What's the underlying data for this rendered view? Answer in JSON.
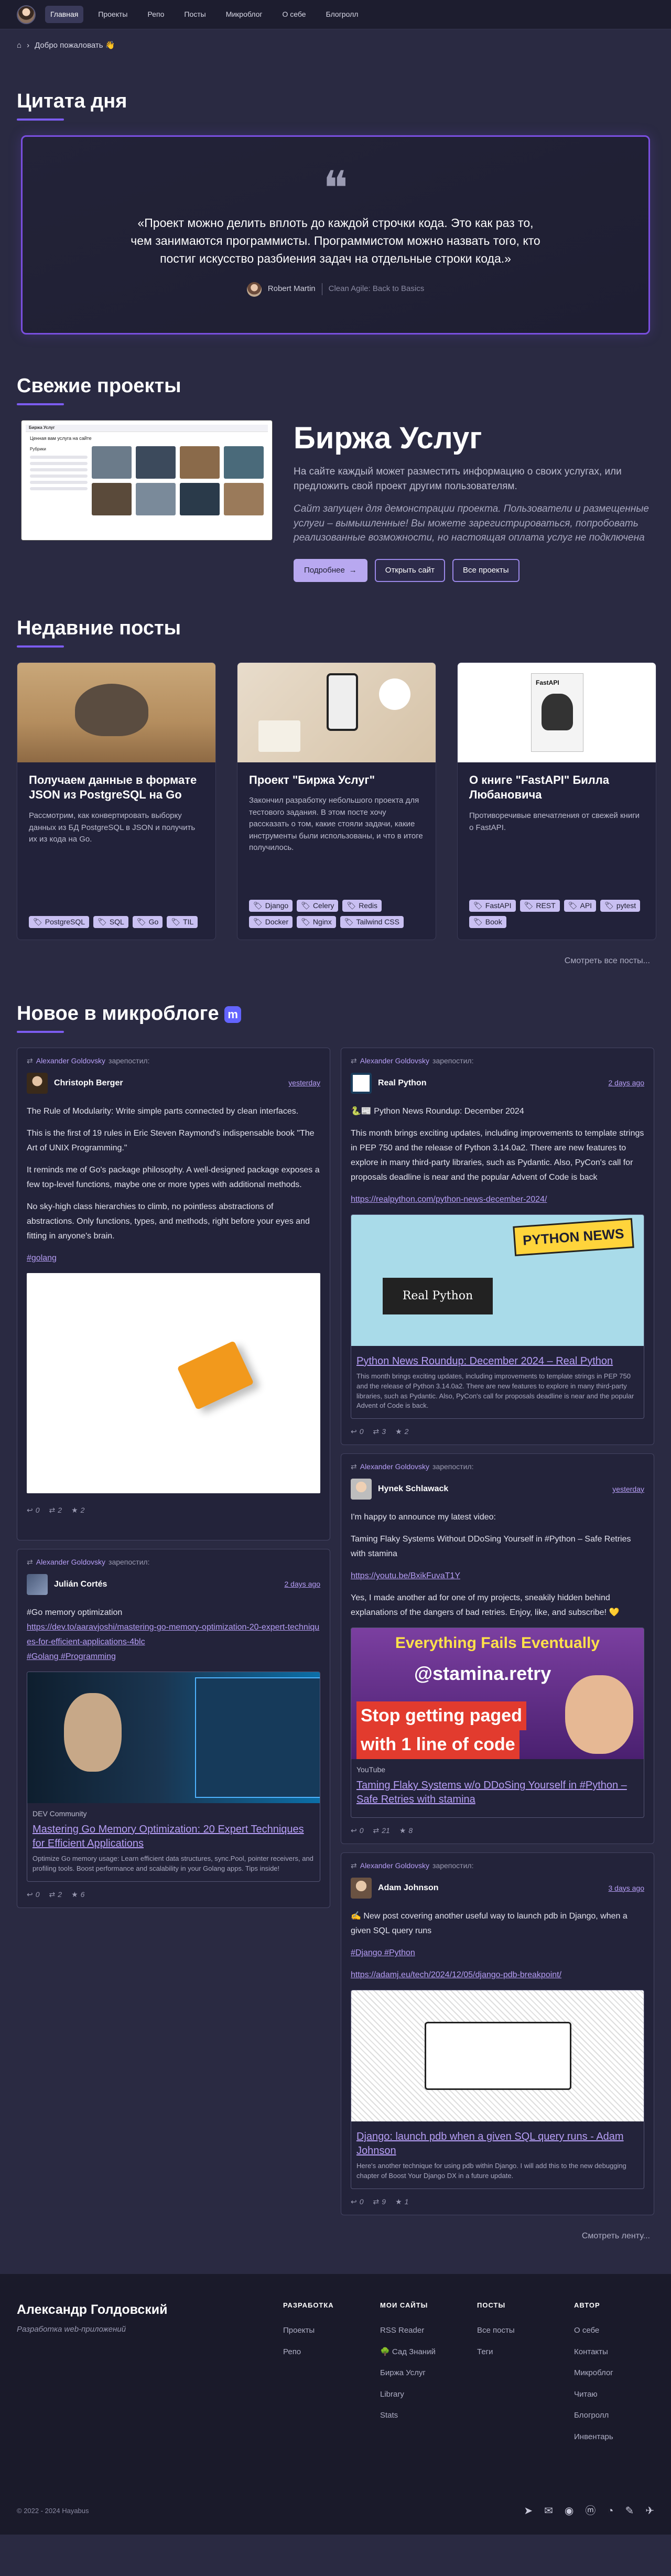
{
  "nav": {
    "items": [
      "Главная",
      "Проекты",
      "Репо",
      "Посты",
      "Микроблог",
      "О себе",
      "Блогролл"
    ]
  },
  "breadcrumb": {
    "text": "Добро пожаловать 👋"
  },
  "quote": {
    "section": "Цитата дня",
    "text": "«Проект можно делить вплоть до каждой строчки кода. Это как раз то, чем занимаются программисты. Программистом можно назвать того, кто постиг искусство разбиения задач на отдельные строки кода.»",
    "author": "Robert Martin",
    "source": "Clean Agile: Back to Basics"
  },
  "projects": {
    "section": "Свежие проекты",
    "title": "Биржа Услуг",
    "desc": "На сайте каждый может разместить информацию о своих услугах, или предложить свой проект другим пользователям.",
    "note": "Сайт запущен для демонстрации проекта. Пользователи и размещенные услуги – вымышленные! Вы можете зарегистрироваться, попробовать реализованные возможности, но настоящая оплата услуг не подключена",
    "btn_more": "Подробнее",
    "btn_open": "Открыть сайт",
    "btn_all": "Все проекты",
    "shot": {
      "brand": "Биржа Услуг",
      "heading": "Ценная вам услуга на сайте",
      "side": "Рубрики"
    }
  },
  "posts": {
    "section": "Недавние посты",
    "see_all": "Смотреть все посты...",
    "items": [
      {
        "title": "Получаем данные в формате JSON из PostgreSQL на Go",
        "desc": "Рассмотрим, как конвертировать выборку данных из БД PostgreSQL в JSON и получить их из кода на Go.",
        "tags": [
          "PostgreSQL",
          "SQL",
          "Go",
          "TIL"
        ]
      },
      {
        "title": "Проект \"Биржа Услуг\"",
        "desc": "Закончил разработку небольшого проекта для тестового задания. В этом посте хочу рассказать о том, какие стояли задачи, какие инструменты были использованы, и что в итоге получилось.",
        "tags": [
          "Django",
          "Celery",
          "Redis",
          "Docker",
          "Nginx",
          "Tailwind CSS"
        ]
      },
      {
        "title": "О книге \"FastAPI\" Билла Любановича",
        "desc": "Противоречивые впечатления от свежей книги о FastAPI.",
        "tags": [
          "FastAPI",
          "REST",
          "API",
          "pytest",
          "Book"
        ],
        "book_label": "FastAPI"
      }
    ]
  },
  "micro": {
    "section": "Новое в микроблоге",
    "see_more": "Смотреть ленту...",
    "repost_user": "Alexander Goldovsky",
    "repost_word": "зарепостил:",
    "left": [
      {
        "name": "Christoph Berger",
        "date": "yesterday",
        "paras": [
          "The Rule of Modularity: Write simple parts connected by clean interfaces.",
          "This is the first of 19 rules in Eric Steven Raymond's indispensable book \"The Art of UNIX Programming.\"",
          "It reminds me of Go's package philosophy. A well-designed package exposes a few top-level functions, maybe one or more types with additional methods.",
          "No sky-high class hierarchies to climb, no pointless abstractions of abstractions. Only functions, types, and methods, right before your eyes and fitting in anyone's brain."
        ],
        "hashtag": "#golang",
        "reply": "0",
        "boost": "2",
        "fav": "2"
      },
      {
        "name": "Julián Cortés",
        "date": "2 days ago",
        "lines": [
          "#Go memory optimization"
        ],
        "link": "https://dev.to/aaravjoshi/mastering-go-memory-optimization-20-expert-techniques-for-efficient-applications-4blc",
        "hashtags": "#Golang #Programming",
        "preview": {
          "src": "DEV Community",
          "title": "Mastering Go Memory Optimization: 20 Expert Techniques for Efficient Applications",
          "desc": "Optimize Go memory usage: Learn efficient data structures, sync.Pool, pointer receivers, and profiling tools. Boost performance and scalability in your Golang apps. Tips inside!"
        },
        "reply": "0",
        "boost": "2",
        "fav": "6"
      }
    ],
    "right": [
      {
        "name": "Real Python",
        "date": "2 days ago",
        "heading": "🐍📰 Python News Roundup: December 2024",
        "text": "This month brings exciting updates, including improvements to template strings in PEP 750 and the release of Python 3.14.0a2. There are new features to explore in many third-party libraries, such as Pydantic. Also, PyCon's call for proposals deadline is near and the popular Advent of Code is back",
        "link": "https://realpython.com/python-news-december-2024/",
        "preview": {
          "badge": "PYTHON NEWS",
          "brand": "Real Python",
          "title": "Python News Roundup: December 2024 – Real Python",
          "desc": "This month brings exciting updates, including improvements to template strings in PEP 750 and the release of Python 3.14.0a2. There are new features to explore in many third-party libraries, such as Pydantic. Also, PyCon's call for proposals deadline is near and the popular Advent of Code is back."
        },
        "reply": "0",
        "boost": "3",
        "fav": "2"
      },
      {
        "name": "Hynek Schlawack",
        "date": "yesterday",
        "lines": [
          "I'm happy to announce my latest video:",
          "Taming Flaky Systems Without DDoSing Yourself in #Python – Safe Retries with stamina"
        ],
        "link": "https://youtu.be/BxikFuvaT1Y",
        "text2": "Yes, I made another ad for one of my projects, sneakily hidden behind explanations of the dangers of bad retries. Enjoy, like, and subscribe! 💛",
        "preview": {
          "src": "YouTube",
          "top": "Everything Fails Eventually",
          "handle": "@stamina.retry",
          "slogan1": "Stop getting paged",
          "slogan2": "with 1 line of code",
          "title": "Taming Flaky Systems w/o DDoSing Yourself in #Python – Safe Retries with stamina"
        },
        "reply": "0",
        "boost": "21",
        "fav": "8"
      },
      {
        "name": "Adam Johnson",
        "date": "3 days ago",
        "text": "✍️ New post covering another useful way to launch pdb in Django, when a given SQL query runs",
        "hashtags": "#Django #Python",
        "link": "https://adamj.eu/tech/2024/12/05/django-pdb-breakpoint/",
        "preview": {
          "title": "Django: launch pdb when a given SQL query runs - Adam Johnson",
          "desc": "Here's another technique for using pdb within Django. I will add this to the new debugging chapter of Boost Your Django DX in a future update."
        },
        "reply": "0",
        "boost": "9",
        "fav": "1"
      }
    ]
  },
  "footer": {
    "name": "Александр Голдовский",
    "sub": "Разработка web-приложений",
    "cols": [
      {
        "title": "РАЗРАБОТКА",
        "items": [
          "Проекты",
          "Репо"
        ]
      },
      {
        "title": "МОИ САЙТЫ",
        "items": [
          "RSS Reader",
          "🌳 Сад Знаний",
          "Биржа Услуг",
          "Library",
          "Stats"
        ]
      },
      {
        "title": "ПОСТЫ",
        "items": [
          "Все посты",
          "Теги"
        ]
      },
      {
        "title": "АВТОР",
        "items": [
          "О себе",
          "Контакты",
          "Микроблог",
          "Читаю",
          "Блогролл",
          "Инвентарь"
        ]
      }
    ],
    "copyright": "© 2022 - 2024 Hayabus"
  },
  "colors": {
    "accent": "#7c5cf0",
    "link": "#b69ef5",
    "bg": "#2a2a42",
    "card": "#23233a"
  }
}
